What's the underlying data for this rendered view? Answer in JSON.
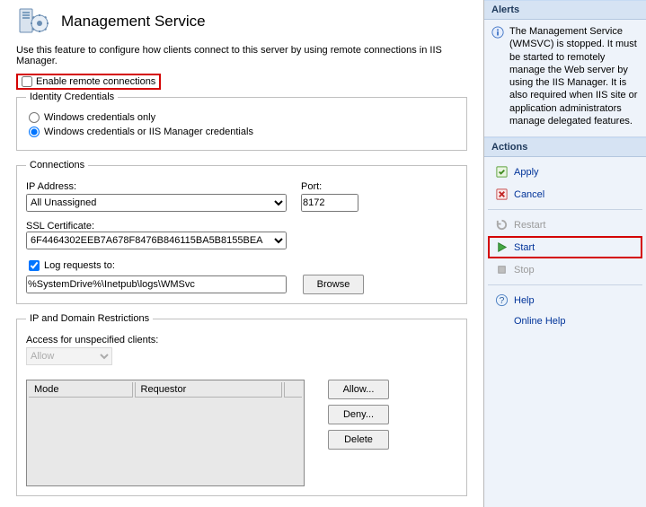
{
  "page": {
    "title": "Management Service",
    "description": "Use this feature to configure how clients connect to this server by using remote connections in IIS Manager.",
    "enable_remote_label": "Enable remote connections"
  },
  "identity": {
    "legend": "Identity Credentials",
    "opt_windows": "Windows credentials only",
    "opt_both": "Windows credentials or IIS Manager credentials"
  },
  "connections": {
    "legend": "Connections",
    "ip_label": "IP Address:",
    "ip_value": "All Unassigned",
    "port_label": "Port:",
    "port_value": "8172",
    "ssl_label": "SSL Certificate:",
    "ssl_value": "6F4464302EEB7A678F8476B846115BA5B8155BEA",
    "log_label": "Log requests to:",
    "log_path": "%SystemDrive%\\Inetpub\\logs\\WMSvc",
    "browse": "Browse"
  },
  "restrictions": {
    "legend": "IP and Domain Restrictions",
    "access_label": "Access for unspecified clients:",
    "access_value": "Allow",
    "col_mode": "Mode",
    "col_requestor": "Requestor",
    "allow": "Allow...",
    "deny": "Deny...",
    "delete": "Delete"
  },
  "alerts": {
    "header": "Alerts",
    "text": "The Management Service (WMSVC) is stopped. It must be started to remotely manage the Web server by using the IIS Manager. It is also required when IIS site or application administrators manage delegated features."
  },
  "actions": {
    "header": "Actions",
    "apply": "Apply",
    "cancel": "Cancel",
    "restart": "Restart",
    "start": "Start",
    "stop": "Stop",
    "help": "Help",
    "online_help": "Online Help"
  }
}
